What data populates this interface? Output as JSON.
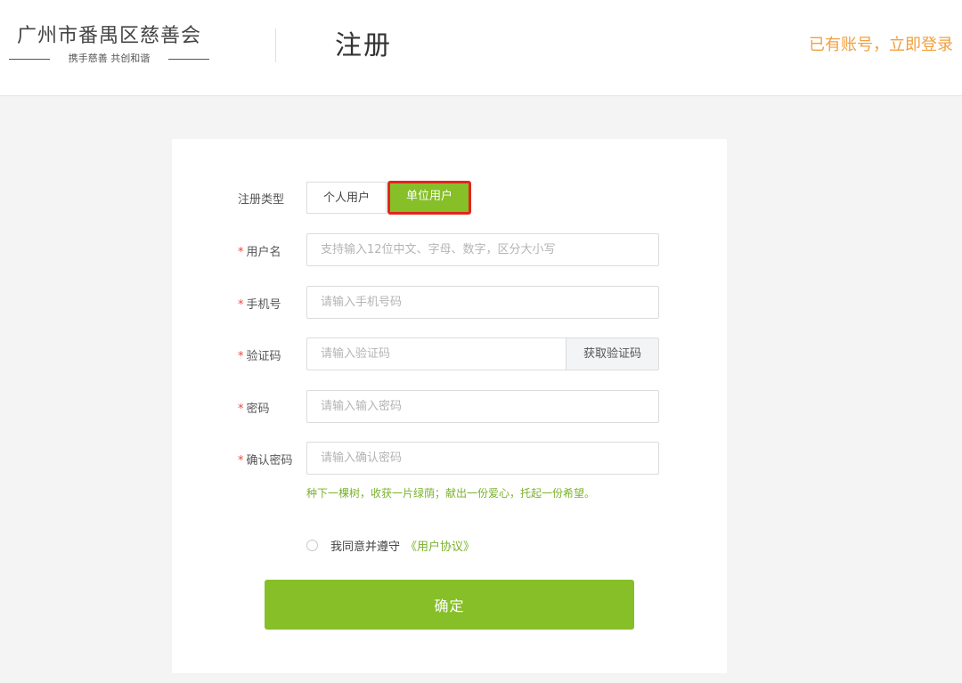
{
  "header": {
    "org_name": "广州市番禺区慈善会",
    "slogan": "携手慈善 共创和谐",
    "page_title": "注册",
    "login_link": "已有账号，立即登录"
  },
  "form": {
    "type_label": "注册类型",
    "type_options": [
      "个人用户",
      "单位用户"
    ],
    "selected_type": "单位用户",
    "required_mark": "*",
    "username": {
      "label": "用户名",
      "placeholder": "支持输入12位中文、字母、数字，区分大小写"
    },
    "phone": {
      "label": "手机号",
      "placeholder": "请输入手机号码"
    },
    "code": {
      "label": "验证码",
      "placeholder": "请输入验证码",
      "button": "获取验证码"
    },
    "password": {
      "label": "密码",
      "placeholder": "请输入输入密码"
    },
    "confirm_password": {
      "label": "确认密码",
      "placeholder": "请输入确认密码"
    },
    "hint": "种下一棵树，收获一片绿荫；献出一份爱心，托起一份希望。",
    "agree_text": "我同意并遵守",
    "agree_link": "《用户协议》",
    "submit": "确定"
  },
  "colors": {
    "accent_green": "#86bf28",
    "link_orange": "#f0a040",
    "required_red": "#e54d42",
    "highlight_red": "#e0261e"
  }
}
